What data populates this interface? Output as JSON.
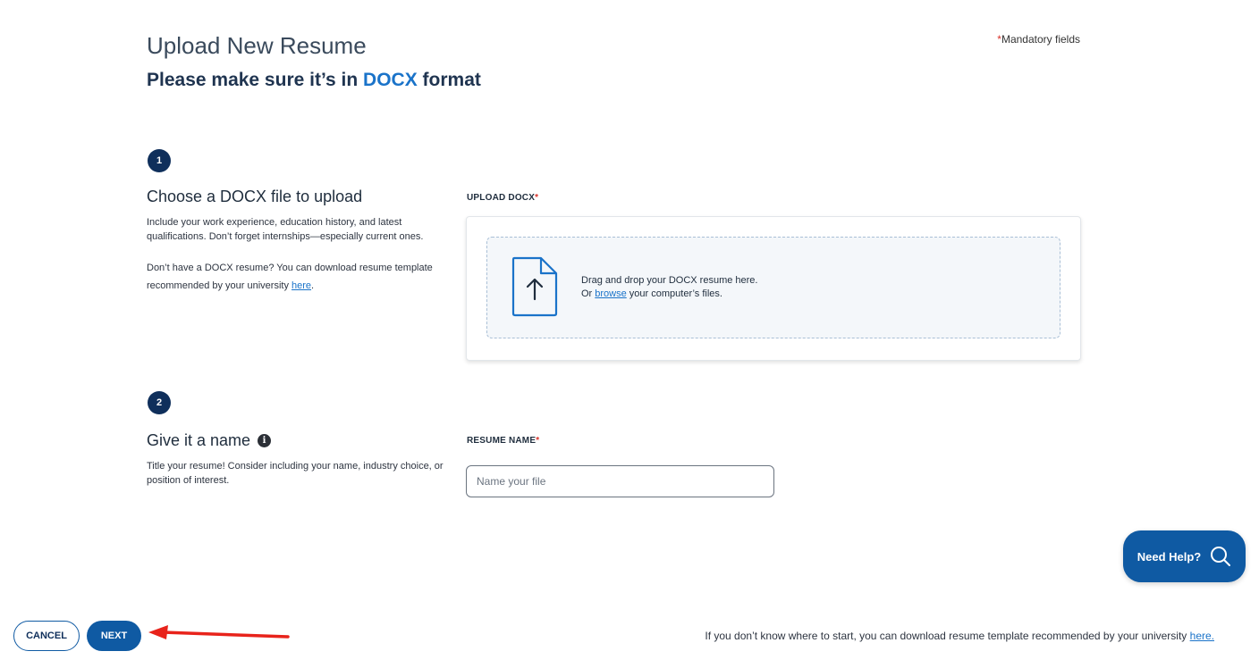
{
  "header": {
    "title": "Upload New Resume",
    "subtitle_prefix": "Please make sure it’s in ",
    "subtitle_accent": "DOCX",
    "subtitle_suffix": " format",
    "mandatory_asterisk": "*",
    "mandatory_text": "Mandatory fields"
  },
  "step1": {
    "number": "1",
    "title": "Choose a DOCX file to upload",
    "desc1": "Include your work experience, education history, and latest qualifications. Don’t forget internships—especially current ones.",
    "desc2_prefix": "Don’t have a DOCX resume? You can download resume template recommended by your university ",
    "desc2_link": "here",
    "desc2_suffix": ".",
    "field_label": "UPLOAD DOCX",
    "field_required": "*",
    "drop_line1": "Drag and drop your DOCX resume here.",
    "drop_line2_prefix": "Or ",
    "drop_line2_link": "browse",
    "drop_line2_suffix": " your computer’s files.",
    "icon": "file-upload-icon"
  },
  "step2": {
    "number": "2",
    "title": "Give it a name",
    "info_icon_glyph": "i",
    "desc": "Title your resume! Consider including your name, industry choice, or position of interest.",
    "field_label": "RESUME NAME",
    "field_required": "*",
    "input_placeholder": "Name your file",
    "input_value": ""
  },
  "help": {
    "label": "Need Help?",
    "icon": "search-icon"
  },
  "actions": {
    "cancel_label": "CANCEL",
    "next_label": "NEXT"
  },
  "footer": {
    "text": "If you don’t know where to start, you can download resume template recommended by your university ",
    "link": "here."
  },
  "colors": {
    "primary": "#0f5aa3",
    "navy": "#0f2f5b",
    "accent": "#1a73c9",
    "required": "#d9332b",
    "annotation_arrow": "#e8231b"
  }
}
